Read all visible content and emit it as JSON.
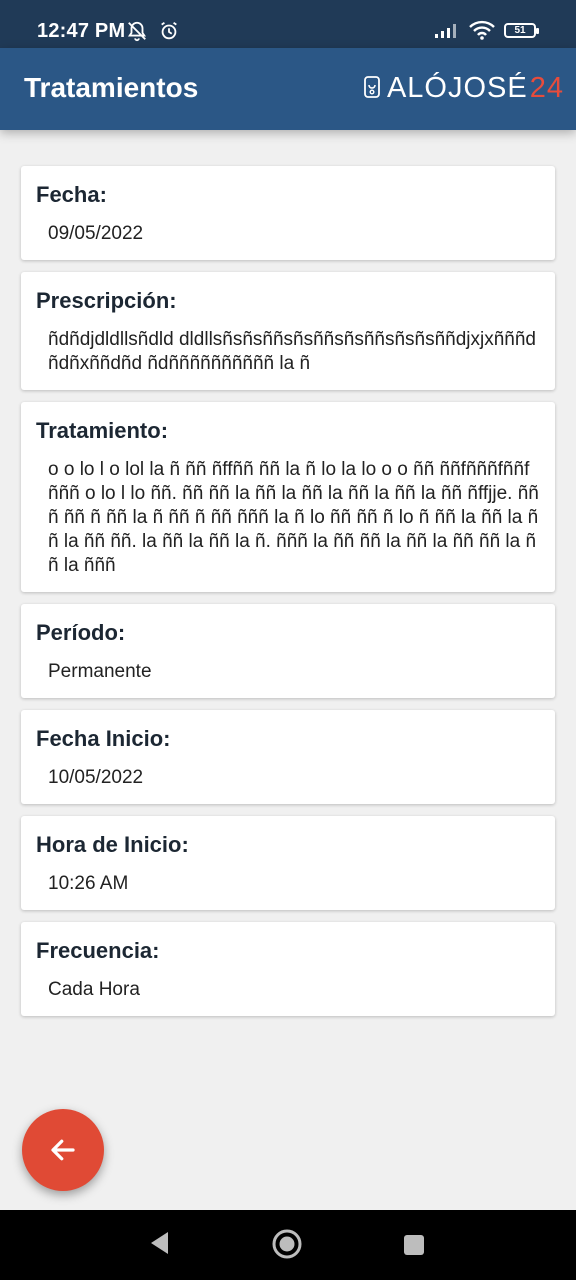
{
  "status_bar": {
    "time": "12:47 PM",
    "battery": "51"
  },
  "app_bar": {
    "title": "Tratamientos",
    "logo_text": "ALÓJOSÉ",
    "logo_number": "24"
  },
  "cards": [
    {
      "label": "Fecha:",
      "value": "09/05/2022"
    },
    {
      "label": "Prescripción:",
      "value": "ñdñdjdldllsñdld dldllsñsñsññsñsññsñsññsñsñsññdjxjxñññdñdñxññdñd ñdññññññññññ la ñ"
    },
    {
      "label": "Tratamiento:",
      "value": "o o lo l o lol la ñ ññ ñffññ ññ la ñ lo la lo o o ññ ññfñññfññfñññ o lo l lo ññ. ññ ññ la ññ la ññ la ññ la ññ la ññ ñffjje. ñññ ññ ñ ññ la ñ ññ ñ ññ ñññ la ñ lo ññ ññ ñ lo ñ ññ la ññ la ññ la ññ ññ. la ññ la ññ la ñ. ñññ la ññ ññ la ññ la ññ ññ la ññ la ñññ"
    },
    {
      "label": "Período:",
      "value": "Permanente"
    },
    {
      "label": "Fecha Inicio:",
      "value": "10/05/2022"
    },
    {
      "label": "Hora de Inicio:",
      "value": "10:26 AM"
    },
    {
      "label": "Frecuencia:",
      "value": "Cada Hora"
    }
  ],
  "colors": {
    "status_bar": "#203a57",
    "app_bar": "#2b5786",
    "fab": "#e04a35",
    "logo_accent": "#e74c3c",
    "background": "#f0f0f0"
  },
  "icons": {
    "fab": "arrow-left-icon",
    "nav": [
      "back-triangle-icon",
      "home-circle-icon",
      "recents-square-icon"
    ]
  }
}
